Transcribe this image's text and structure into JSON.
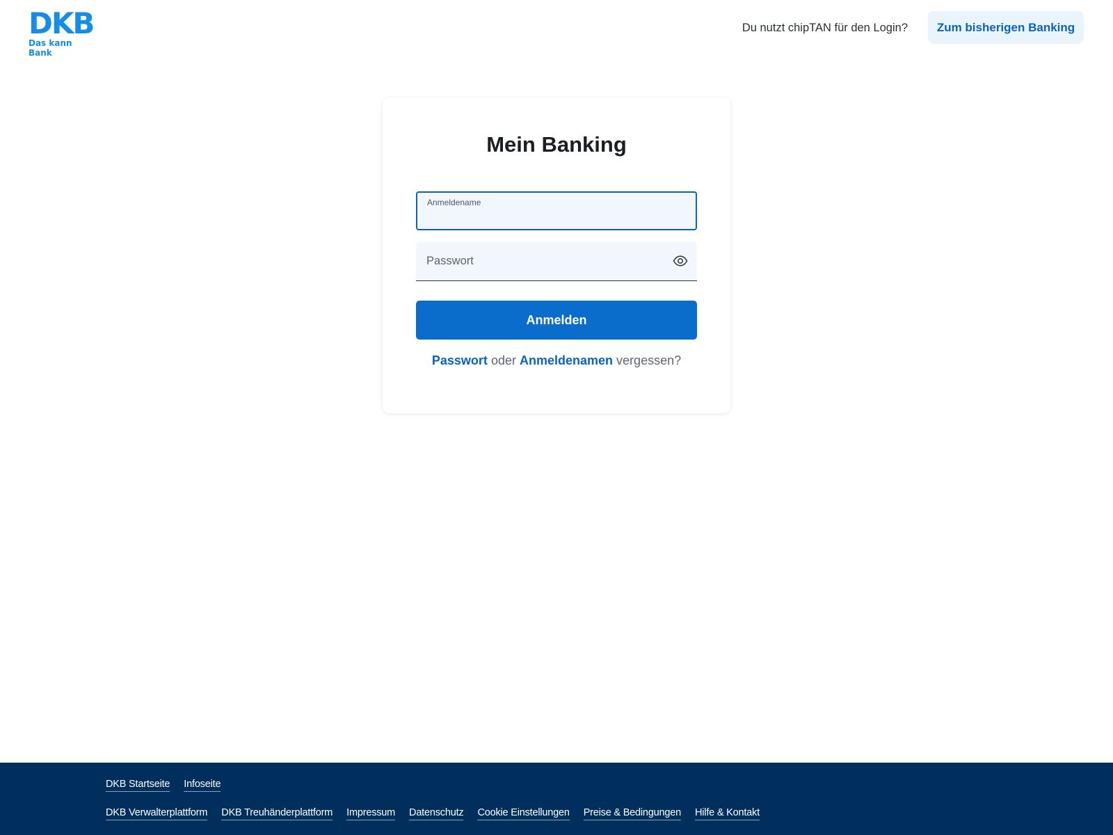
{
  "header": {
    "logo": {
      "brand": "DKB",
      "slogan": "Das kann Bank"
    },
    "question": "Du nutzt chipTAN für den Login?",
    "legacy_button": "Zum bisherigen Banking"
  },
  "login": {
    "title": "Mein Banking",
    "username": {
      "label": "Anmeldename",
      "value": ""
    },
    "password": {
      "placeholder": "Passwort",
      "value": "",
      "toggle_icon": "eye-icon"
    },
    "submit": "Anmelden",
    "forgot": {
      "password_link": "Passwort",
      "connector": "oder",
      "username_link": "Anmeldenamen",
      "suffix": "vergessen?"
    }
  },
  "footer": {
    "row1": [
      "DKB Startseite",
      "Infoseite"
    ],
    "row2": [
      "DKB Verwalterplattform",
      "DKB Treuhänderplattform",
      "Impressum",
      "Datenschutz",
      "Cookie Einstellungen",
      "Preise & Bedingungen",
      "Hilfe & Kontakt"
    ]
  },
  "colors": {
    "brand": "#148dea",
    "primary": "#0a6ccb",
    "link": "#0a63c2",
    "footer_bg": "#002f5d"
  }
}
